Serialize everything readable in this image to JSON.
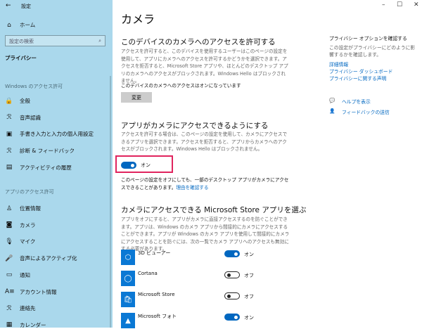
{
  "window": {
    "title": "設定",
    "minimize": "–",
    "maximize": "☐",
    "close": "✕"
  },
  "sidebar": {
    "back": "←",
    "home": "ホーム",
    "search_placeholder": "設定の検索",
    "section": "プライバシー",
    "group1": "Windows のアクセス許可",
    "group1_items": [
      {
        "icon": "lock-icon",
        "glyph": "🔒",
        "label": "全般"
      },
      {
        "icon": "speech-icon",
        "glyph": "ℛ",
        "label": "音声認識"
      },
      {
        "icon": "clipboard-icon",
        "glyph": "▣",
        "label": "手書き入力と入力の個人用設定"
      },
      {
        "icon": "feedback-icon",
        "glyph": "ℛ",
        "label": "診断 & フィードバック"
      },
      {
        "icon": "timeline-icon",
        "glyph": "▤",
        "label": "アクティビティの履歴"
      }
    ],
    "group2": "アプリのアクセス許可",
    "group2_items": [
      {
        "icon": "location-icon",
        "glyph": "♙",
        "label": "位置情報"
      },
      {
        "icon": "camera-icon",
        "glyph": "◙",
        "label": "カメラ"
      },
      {
        "icon": "microphone-icon",
        "glyph": "🎙",
        "label": "マイク"
      },
      {
        "icon": "voice-activation-icon",
        "glyph": "🎤",
        "label": "音声によるアクティブ化"
      },
      {
        "icon": "notification-icon",
        "glyph": "▭",
        "label": "通知"
      },
      {
        "icon": "account-info-icon",
        "glyph": "A≡",
        "label": "アカウント情報"
      },
      {
        "icon": "contacts-icon",
        "glyph": "ℛ",
        "label": "連絡先"
      },
      {
        "icon": "calendar-icon",
        "glyph": "▦",
        "label": "カレンダー"
      }
    ]
  },
  "main": {
    "title": "カメラ",
    "s1_title": "このデバイスのカメラへのアクセスを許可する",
    "s1_desc": "アクセスを許可すると、このデバイスを使用するユーザーはこのページの設定を使用して、アプリにカメラへのアクセスを許可するかどうかを選択できます。アクセスを拒否すると、Microsoft Store アプリや、ほとんどのデスクトップ アプリのカメラへのアクセスがブロックされます。Windows Hello はブロックされません。",
    "s1_status": "このデバイスのカメラへのアクセスはオンになっています",
    "s1_button": "変更",
    "s2_title": "アプリがカメラにアクセスできるようにする",
    "s2_desc": "アクセスを許可する場合は、このページの設定を使用して、カメラにアクセスできるアプリを選択できます。アクセスを拒否すると、アプリからカメラへのアクセスがブロックされます。Windows Hello はブロックされません。",
    "s2_toggle_label": "オン",
    "s2_note": "このページの設定をオフにしても、一部のデスクトップ アプリがカメラにアクセスできることがあります。",
    "s2_link": "理由を確認する",
    "s3_title": "カメラにアクセスできる Microsoft Store アプリを選ぶ",
    "s3_desc": "アプリをオフにすると、アプリがカメラに直接アクセスするのを防ぐことができます。アプリは、Windows のカメラ アプリから間接的にカメラにアクセスすることができます。アプリが Windows のカメラ アプリを使用して間接的にカメラにアクセスすることを防ぐには、次の一覧でカメラ アプリへのアクセスも無効にする必要があります。",
    "apps": [
      {
        "name": "3D ビューアー",
        "state": "オン",
        "on": true,
        "icon": "3d-viewer-icon",
        "glyph": "⬡"
      },
      {
        "name": "Cortana",
        "state": "オフ",
        "on": false,
        "icon": "cortana-icon",
        "glyph": "◯"
      },
      {
        "name": "Microsoft Store",
        "state": "オフ",
        "on": false,
        "icon": "store-icon",
        "glyph": "🛍"
      },
      {
        "name": "Microsoft フォト",
        "state": "オン",
        "on": true,
        "icon": "photos-icon",
        "glyph": "▲"
      }
    ]
  },
  "right": {
    "title": "プライバシー オプションを確認する",
    "desc": "この設定がプライバシーにどのように影響するかを確認します。",
    "links": [
      "詳細情報",
      "プライバシー ダッシュボード",
      "プライバシーに関する声明"
    ],
    "help": "ヘルプを表示",
    "feedback": "フィードバックの送信"
  },
  "colors": {
    "accent": "#0067c0",
    "sidebar": "#aad8ec",
    "highlight": "#e0245e"
  }
}
